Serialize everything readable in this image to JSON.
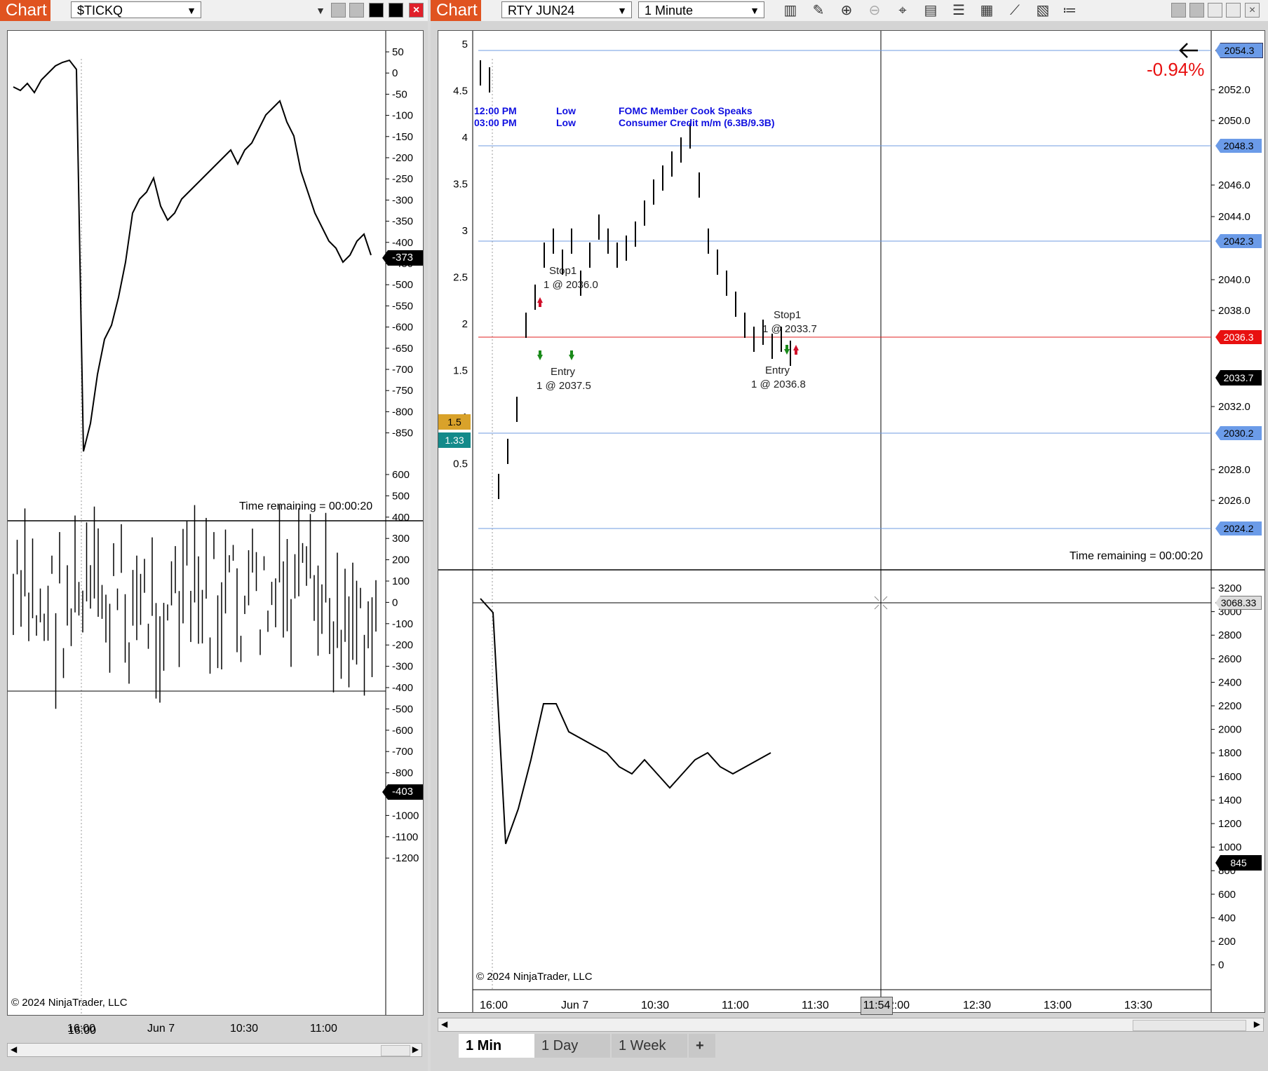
{
  "left": {
    "chart_label": "Chart",
    "instrument": "$TICKQ",
    "upper_axis": [
      "50",
      "0",
      "-50",
      "-100",
      "-150",
      "-200",
      "-250",
      "-300",
      "-350",
      "-400",
      "-450",
      "-500",
      "-550",
      "-600",
      "-650",
      "-700",
      "-750",
      "-800",
      "-850"
    ],
    "upper_last": "-373",
    "lower_axis": [
      "600",
      "500",
      "400",
      "300",
      "200",
      "100",
      "0",
      "-100",
      "-200",
      "-300",
      "-400",
      "-500",
      "-600",
      "-700",
      "-800",
      "-900",
      "-1000",
      "-1100",
      "-1200"
    ],
    "lower_last": "-403",
    "time_remaining": "Time remaining = 00:00:20",
    "copyright": "© 2024 NinjaTrader, LLC",
    "x_labels": [
      "16:00",
      "Jun 7",
      "10:30",
      "11:00"
    ]
  },
  "right": {
    "chart_label": "Chart",
    "instrument": "RTY JUN24",
    "interval": "1 Minute",
    "left_axis": [
      "5",
      "4.5",
      "4",
      "3.5",
      "3",
      "2.5",
      "2",
      "1.5",
      "1",
      "0.5"
    ],
    "left_markers": {
      "orange": "1.5",
      "teal": "1.33"
    },
    "right_axis": [
      "2052.0",
      "2050.0",
      "2046.0",
      "2044.0",
      "2040.0",
      "2038.0",
      "2032.0",
      "2028.0",
      "2026.0"
    ],
    "price_boxes": {
      "blue_a": "2054.3",
      "blue_b": "2048.3",
      "blue_c": "2042.3",
      "red": "2036.3",
      "black": "2033.7",
      "blue_d": "2030.2",
      "blue_e": "2024.2"
    },
    "pct_change": "-0.94%",
    "events": [
      {
        "time": "12:00 PM",
        "impact": "Low",
        "name": "FOMC Member Cook Speaks"
      },
      {
        "time": "03:00 PM",
        "impact": "Low",
        "name": "Consumer Credit m/m (6.3B/9.3B)"
      }
    ],
    "trade_labels": {
      "stop1_a": "Stop1",
      "stop1_a_px": "1 @ 2036.0",
      "entry_a": "Entry",
      "entry_a_px": "1 @ 2037.5",
      "stop1_b": "Stop1",
      "stop1_b_px": "1 @ 2033.7",
      "entry_b": "Entry",
      "entry_b_px": "1 @ 2036.8"
    },
    "time_remaining": "Time remaining = 00:00:20",
    "lower_axis": [
      "3200",
      "3000",
      "2800",
      "2600",
      "2400",
      "2200",
      "2000",
      "1800",
      "1600",
      "1400",
      "1200",
      "1000",
      "800",
      "600",
      "400",
      "200",
      "0"
    ],
    "lower_crosshair": "3068.33",
    "lower_last": "845",
    "copyright": "© 2024 NinjaTrader, LLC",
    "x_labels": [
      "16:00",
      "Jun 7",
      "10:30",
      "11:00",
      "11:30",
      "12:00",
      "12:30",
      "13:00",
      "13:30"
    ],
    "crosshair_time": "11:54",
    "tabs": [
      "1 Min",
      "1 Day",
      "1 Week"
    ],
    "add_tab": "+"
  },
  "colors": {
    "brand": "#e05320",
    "blue_line": "#6f9be0",
    "red_line": "#e02020",
    "price_box_blue": "#6b9be8"
  }
}
